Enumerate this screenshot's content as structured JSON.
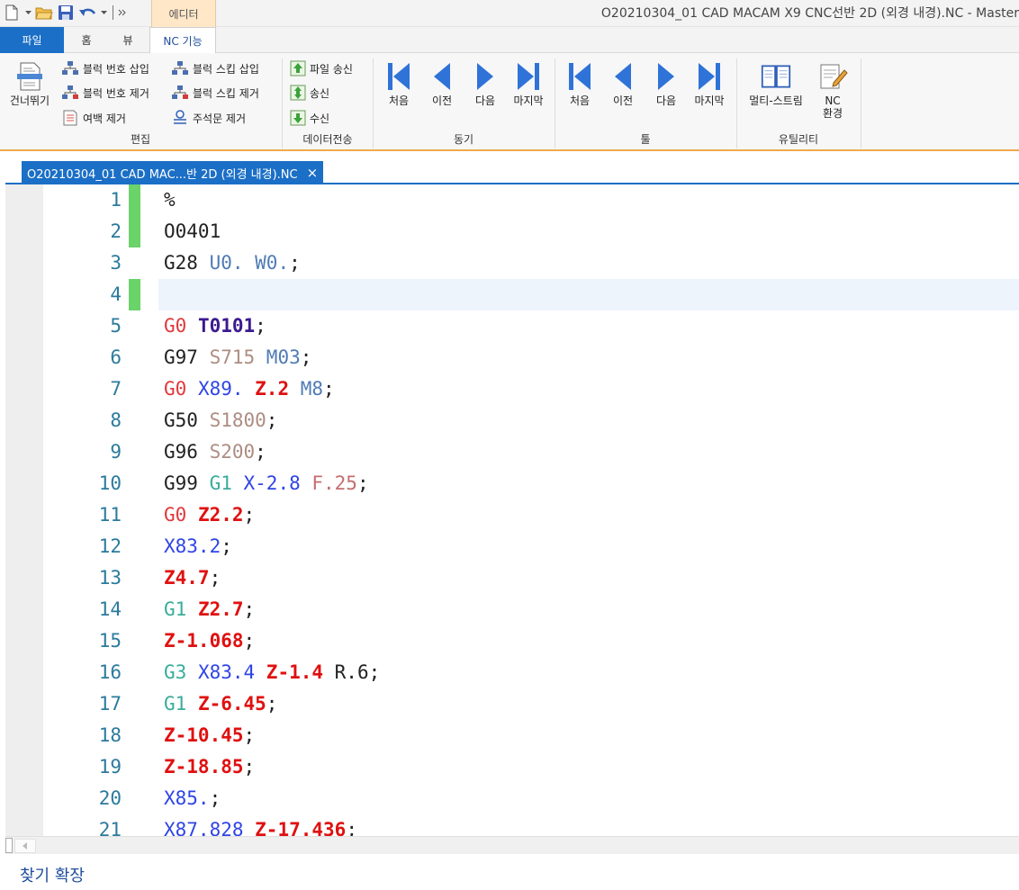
{
  "window": {
    "title": "O20210304_01 CAD MACAM X9 CNC선반 2D (외경 내경).NC - Master",
    "context_tab": "에디터"
  },
  "ribbon": {
    "tabs": [
      "파일",
      "홈",
      "뷰",
      "NC 기능"
    ],
    "active_tab": "NC 기능",
    "groups": {
      "edit": {
        "label": "편집",
        "skip_label": "건너뛰기",
        "items": [
          "블럭 번호 삽입",
          "블럭 번호 제거",
          "여백 제거",
          "블럭 스킵 삽입",
          "블럭 스킵 제거",
          "주석문 제거"
        ]
      },
      "transfer": {
        "label": "데이터전송",
        "items": [
          "파일 송신",
          "송신",
          "수신"
        ]
      },
      "sync": {
        "label": "동기",
        "items": [
          "처음",
          "이전",
          "다음",
          "마지막"
        ]
      },
      "tool": {
        "label": "툴",
        "items": [
          "처음",
          "이전",
          "다음",
          "마지막"
        ]
      },
      "utility": {
        "label": "유틸리티",
        "multi_stream": "멀티-스트림",
        "nc_env_line1": "NC",
        "nc_env_line2": "환경"
      }
    }
  },
  "document_tab": {
    "label": "O20210304_01 CAD MAC...반 2D (외경 내경).NC",
    "close": "×"
  },
  "editor": {
    "current_line": 4,
    "lines": [
      {
        "n": "1",
        "changed": true,
        "tokens": [
          {
            "t": "%",
            "c": "plain"
          }
        ]
      },
      {
        "n": "2",
        "changed": true,
        "tokens": [
          {
            "t": "O0401",
            "c": "plain"
          }
        ]
      },
      {
        "n": "3",
        "changed": false,
        "tokens": [
          {
            "t": "G28 ",
            "c": "plain"
          },
          {
            "t": "U0. ",
            "c": "m"
          },
          {
            "t": "W0.",
            "c": "m"
          },
          {
            "t": ";",
            "c": "plain"
          }
        ]
      },
      {
        "n": "4",
        "changed": true,
        "tokens": []
      },
      {
        "n": "5",
        "changed": false,
        "tokens": [
          {
            "t": "G0 ",
            "c": "gred"
          },
          {
            "t": "T0101",
            "c": "t"
          },
          {
            "t": ";",
            "c": "plain"
          }
        ]
      },
      {
        "n": "6",
        "changed": false,
        "tokens": [
          {
            "t": "G97 ",
            "c": "plain"
          },
          {
            "t": "S715 ",
            "c": "s"
          },
          {
            "t": "M03",
            "c": "m"
          },
          {
            "t": ";",
            "c": "plain"
          }
        ]
      },
      {
        "n": "7",
        "changed": false,
        "tokens": [
          {
            "t": "G0 ",
            "c": "gred"
          },
          {
            "t": "X89. ",
            "c": "x"
          },
          {
            "t": "Z.2 ",
            "c": "z"
          },
          {
            "t": "M8",
            "c": "m"
          },
          {
            "t": ";",
            "c": "plain"
          }
        ]
      },
      {
        "n": "8",
        "changed": false,
        "tokens": [
          {
            "t": "G50 ",
            "c": "plain"
          },
          {
            "t": "S1800",
            "c": "s"
          },
          {
            "t": ";",
            "c": "plain"
          }
        ]
      },
      {
        "n": "9",
        "changed": false,
        "tokens": [
          {
            "t": "G96 ",
            "c": "plain"
          },
          {
            "t": "S200",
            "c": "s"
          },
          {
            "t": ";",
            "c": "plain"
          }
        ]
      },
      {
        "n": "10",
        "changed": false,
        "tokens": [
          {
            "t": "G99 ",
            "c": "plain"
          },
          {
            "t": "G1 ",
            "c": "gteal"
          },
          {
            "t": "X-2.8 ",
            "c": "x"
          },
          {
            "t": "F.25",
            "c": "f"
          },
          {
            "t": ";",
            "c": "plain"
          }
        ]
      },
      {
        "n": "11",
        "changed": false,
        "tokens": [
          {
            "t": "G0 ",
            "c": "gred"
          },
          {
            "t": "Z2.2",
            "c": "z"
          },
          {
            "t": ";",
            "c": "plain"
          }
        ]
      },
      {
        "n": "12",
        "changed": false,
        "tokens": [
          {
            "t": "X83.2",
            "c": "x"
          },
          {
            "t": ";",
            "c": "plain"
          }
        ]
      },
      {
        "n": "13",
        "changed": false,
        "tokens": [
          {
            "t": "Z4.7",
            "c": "z"
          },
          {
            "t": ";",
            "c": "plain"
          }
        ]
      },
      {
        "n": "14",
        "changed": false,
        "tokens": [
          {
            "t": "G1 ",
            "c": "gteal"
          },
          {
            "t": "Z2.7",
            "c": "z"
          },
          {
            "t": ";",
            "c": "plain"
          }
        ]
      },
      {
        "n": "15",
        "changed": false,
        "tokens": [
          {
            "t": "Z-1.068",
            "c": "z"
          },
          {
            "t": ";",
            "c": "plain"
          }
        ]
      },
      {
        "n": "16",
        "changed": false,
        "tokens": [
          {
            "t": "G3 ",
            "c": "gteal"
          },
          {
            "t": "X83.4 ",
            "c": "x"
          },
          {
            "t": "Z-1.4 ",
            "c": "z"
          },
          {
            "t": "R.6",
            "c": "r"
          },
          {
            "t": ";",
            "c": "plain"
          }
        ]
      },
      {
        "n": "17",
        "changed": false,
        "tokens": [
          {
            "t": "G1 ",
            "c": "gteal"
          },
          {
            "t": "Z-6.45",
            "c": "z"
          },
          {
            "t": ";",
            "c": "plain"
          }
        ]
      },
      {
        "n": "18",
        "changed": false,
        "tokens": [
          {
            "t": "Z-10.45",
            "c": "z"
          },
          {
            "t": ";",
            "c": "plain"
          }
        ]
      },
      {
        "n": "19",
        "changed": false,
        "tokens": [
          {
            "t": "Z-18.85",
            "c": "z"
          },
          {
            "t": ";",
            "c": "plain"
          }
        ]
      },
      {
        "n": "20",
        "changed": false,
        "tokens": [
          {
            "t": "X85.",
            "c": "x"
          },
          {
            "t": ";",
            "c": "plain"
          }
        ]
      },
      {
        "n": "21",
        "changed": false,
        "tokens": [
          {
            "t": "X87.828 ",
            "c": "x"
          },
          {
            "t": "Z-17.436",
            "c": "z"
          },
          {
            "t": ";",
            "c": "plain"
          }
        ]
      }
    ]
  },
  "find_panel": {
    "expand_label": "찾기 확장"
  },
  "colors": {
    "accent": "#1b6fc6",
    "ribbon_border": "#f0a94d",
    "changed_marker": "#6ad36a"
  }
}
